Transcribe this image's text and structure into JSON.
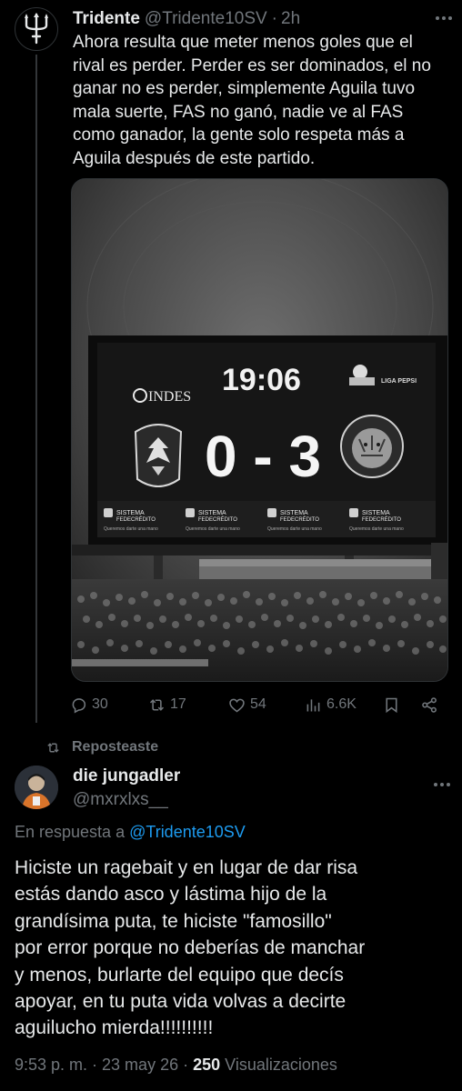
{
  "tweet": {
    "author_name": "Tridente",
    "author_handle": "@Tridente10SV",
    "separator": "·",
    "time": "2h",
    "text_lines": [
      "Ahora resulta que meter menos goles que el",
      "rival es perder. Perder es ser dominados, el no",
      "ganar no es perder, simplemente Aguila tuvo",
      "mala suerte, FAS no ganó, nadie ve al FAS",
      "como ganador, la gente solo respeta más a",
      "Aguila después de este partido."
    ],
    "media": {
      "scoreboard_brand": "INDES",
      "clock": "19:06",
      "score": "0 - 3",
      "league_logo_text": "LIGA PEPSI",
      "sponsor_name_line1": "SISTEMA",
      "sponsor_name_line2": "FEDECRÉDITO",
      "sponsor_tagline": "Queremos darte una mano"
    },
    "actions": {
      "replies": "30",
      "reposts": "17",
      "likes": "54",
      "views": "6.6K"
    }
  },
  "repost_label": "Reposteaste",
  "reply": {
    "author_name": "die jungadler",
    "author_handle": "@mxrxlxs__",
    "reply_prefix": "En respuesta a",
    "reply_to": "@Tridente10SV",
    "text_lines": [
      "Hiciste un ragebait y en lugar de dar risa",
      "estás dando asco y lástima hijo de la",
      "grandísima puta, te hiciste \"famosillo\"",
      "por error porque no deberías de manchar",
      "y menos, burlarte del equipo que decís",
      "apoyar, en tu puta vida volvas a decirte",
      "aguilucho mierda!!!!!!!!!!"
    ],
    "timestamp": "9:53 p. m. · 23 may 26 ·",
    "views_count": "250",
    "views_label": "Visualizaciones"
  },
  "colors": {
    "background": "#000000",
    "text_primary": "#e7e9ea",
    "text_muted": "#71767b",
    "link": "#1d9bf0"
  },
  "icons": [
    "trident-icon",
    "more-icon",
    "reply-icon",
    "repost-icon",
    "like-icon",
    "views-icon",
    "bookmark-icon",
    "share-icon"
  ]
}
